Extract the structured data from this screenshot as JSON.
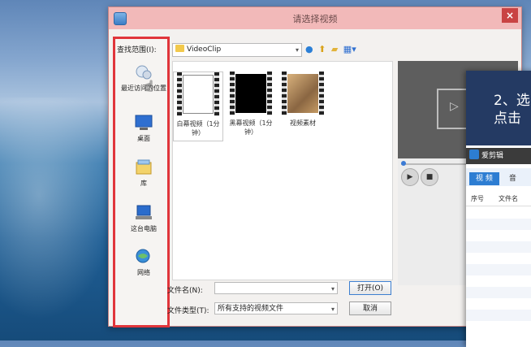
{
  "dialog": {
    "title": "请选择视频",
    "close_label": "×",
    "look_in_label": "查找范围(I):",
    "path_value": "VideoClip",
    "places": [
      {
        "label": "最近访问的位置",
        "icon": "recent-places-icon"
      },
      {
        "label": "桌面",
        "icon": "desktop-icon"
      },
      {
        "label": "库",
        "icon": "library-icon"
      },
      {
        "label": "这台电脑",
        "icon": "computer-icon"
      },
      {
        "label": "网络",
        "icon": "network-icon"
      }
    ],
    "files": [
      {
        "name": "白幕视频（1分钟）",
        "frame_color": "#ffffff"
      },
      {
        "name": "黑幕视频（1分钟）",
        "frame_color": "#000000"
      },
      {
        "name": "视频素材",
        "frame_color": "#b98a5a"
      }
    ],
    "filename_label": "文件名(N):",
    "filename_value": "",
    "filetype_label": "文件类型(T):",
    "filetype_value": "所有支持的视频文件",
    "open_button": "打开(O)",
    "cancel_button": "取消"
  },
  "overlay": {
    "step_text_line1": "2、选",
    "step_text_line2": "点击",
    "app_name": "爱剪辑",
    "tabs": [
      "视 频",
      "音"
    ],
    "columns": [
      "序号",
      "文件名"
    ]
  },
  "colors": {
    "highlight": "#e0353b",
    "titlebar": "#f2b9b9",
    "overlay_header": "#243a63",
    "accent": "#2d7dd2"
  }
}
